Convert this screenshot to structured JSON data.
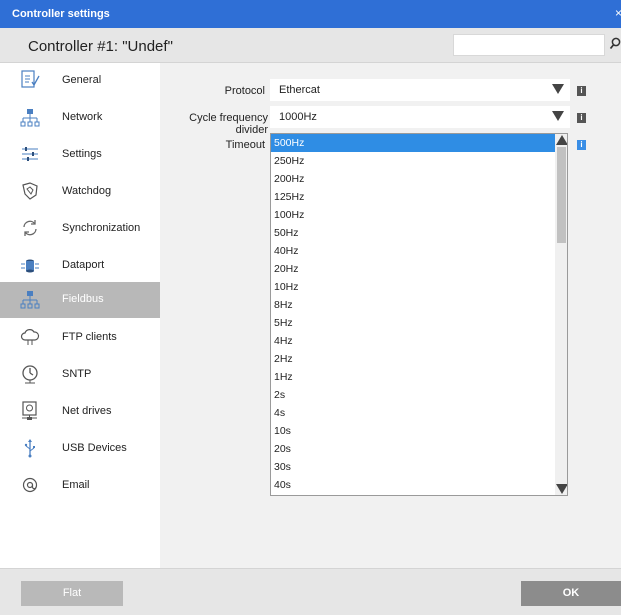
{
  "window": {
    "title": "Controller settings",
    "close_glyph": "×"
  },
  "header": {
    "controller_title": "Controller #1: \"Undef\"",
    "search_value": ""
  },
  "sidebar": {
    "items": [
      {
        "label": "General",
        "icon": "document-check-icon"
      },
      {
        "label": "Network",
        "icon": "network-icon"
      },
      {
        "label": "Settings",
        "icon": "sliders-icon"
      },
      {
        "label": "Watchdog",
        "icon": "watchdog-icon"
      },
      {
        "label": "Synchronization",
        "icon": "sync-icon"
      },
      {
        "label": "Dataport",
        "icon": "dataport-icon"
      },
      {
        "label": "Fieldbus",
        "icon": "fieldbus-icon",
        "active": true
      },
      {
        "label": "FTP clients",
        "icon": "ftp-cloud-icon"
      },
      {
        "label": "SNTP",
        "icon": "clock-icon"
      },
      {
        "label": "Net drives",
        "icon": "net-drive-icon"
      },
      {
        "label": "USB Devices",
        "icon": "usb-icon"
      },
      {
        "label": "Email",
        "icon": "at-icon"
      }
    ]
  },
  "form": {
    "protocol_label": "Protocol",
    "protocol_value": "Ethercat",
    "cycle_label": "Cycle frequency divider",
    "cycle_value": "1000Hz",
    "timeout_label": "Timeout",
    "info_glyph": "i"
  },
  "dropdown": {
    "options": [
      "500Hz",
      "250Hz",
      "200Hz",
      "125Hz",
      "100Hz",
      "50Hz",
      "40Hz",
      "20Hz",
      "10Hz",
      "8Hz",
      "5Hz",
      "4Hz",
      "2Hz",
      "1Hz",
      "2s",
      "4s",
      "10s",
      "20s",
      "30s",
      "40s"
    ],
    "selected_index": 0
  },
  "footer": {
    "flat_label": "Flat",
    "ok_label": "OK"
  },
  "colors": {
    "titlebar": "#2f6fd6",
    "selection": "#2f8de4",
    "active_item": "#b8b8b8"
  }
}
